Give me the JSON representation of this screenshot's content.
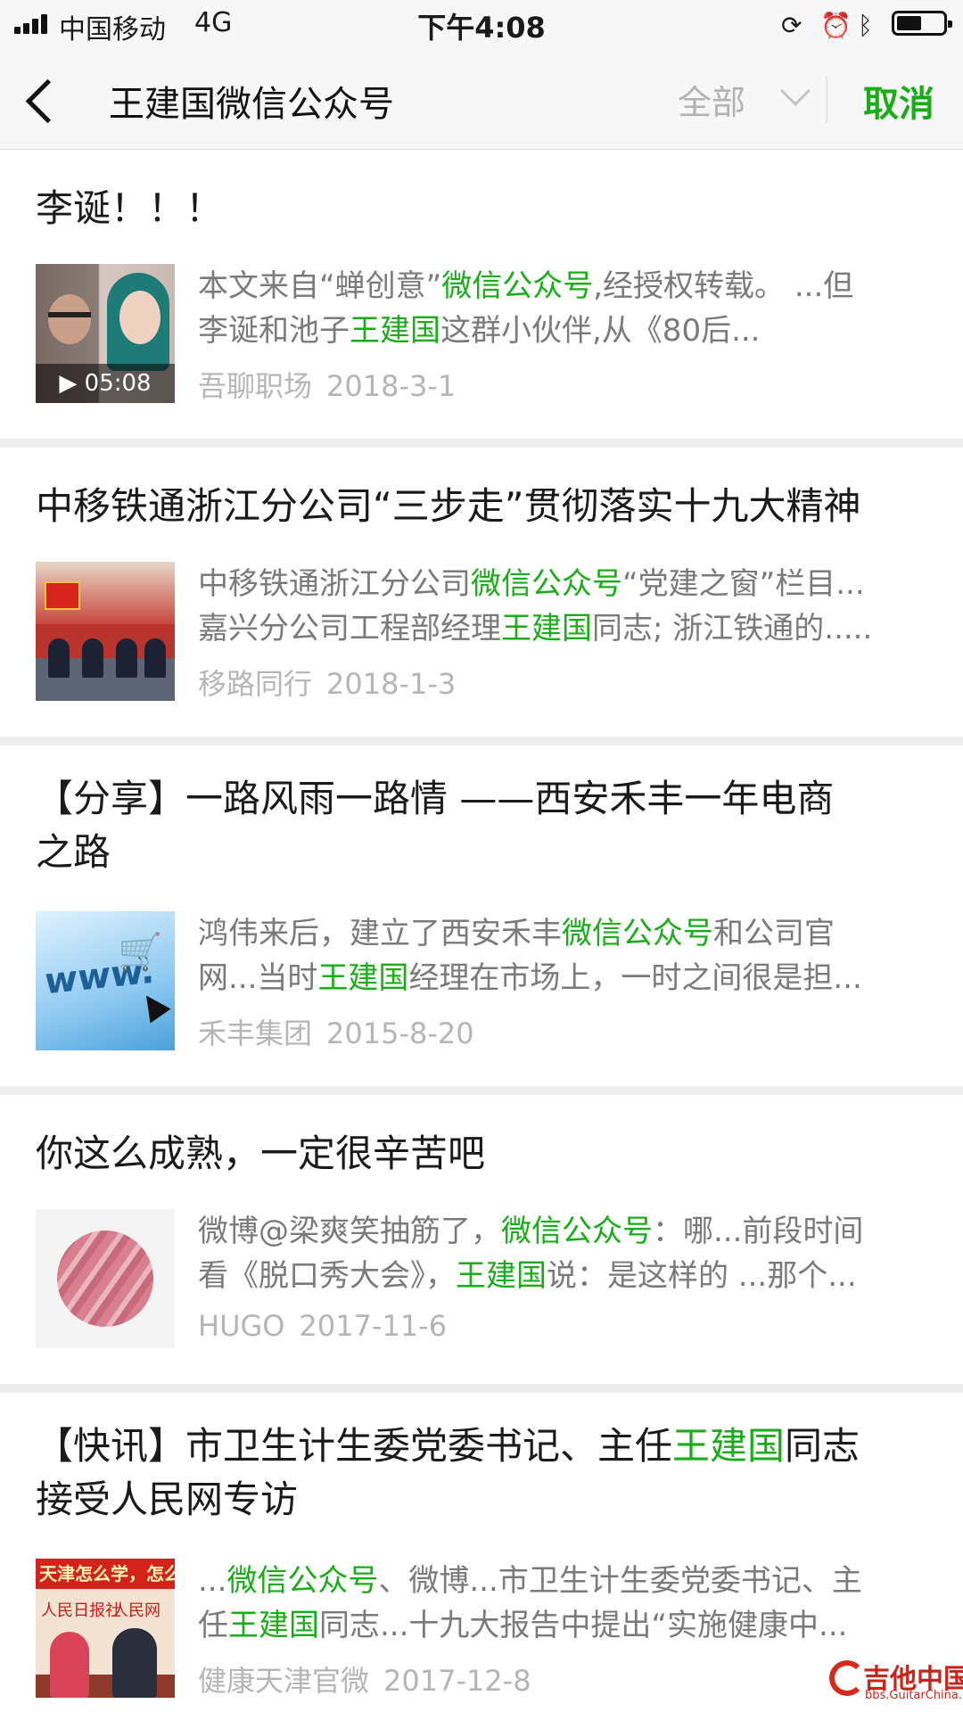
{
  "status_bar": {
    "carrier": "中国移动",
    "network": "4G",
    "time": "下午4:08"
  },
  "header": {
    "title": "王建国微信公众号",
    "filter_label": "全部",
    "cancel_label": "取消"
  },
  "colors": {
    "accent_green": "#1aad19",
    "snippet_gray": "#7a7a7a",
    "meta_gray": "#b5b5b5"
  },
  "results": [
    {
      "title": "李诞！！！",
      "thumb_duration": "▶ 05:08",
      "line1": {
        "a": "本文来自“蝉创意”",
        "hl": "微信公众号",
        "b": ",经授权转载。 ...但"
      },
      "line2": {
        "a": "李诞和池子",
        "hl": "王建国",
        "b": "这群小伙伴,从《80后..."
      },
      "source": "吾聊职场",
      "date": "2018-3-1"
    },
    {
      "title": "中移铁通浙江分公司“三步走”贯彻落实十九大精神",
      "line1": {
        "a": "中移铁通浙江分公司",
        "hl": "微信公众号",
        "b": "“党建之窗”栏目..."
      },
      "line2": {
        "a": "嘉兴分公司工程部经理",
        "hl": "王建国",
        "b": "同志; 浙江铁通的....."
      },
      "source": "移路同行",
      "date": "2018-1-3"
    },
    {
      "title_line1": "【分享】一路风雨一路情 ——西安禾丰一年电商",
      "title_line2": "之路",
      "line1": {
        "a": "鸿伟来后，建立了西安禾丰",
        "hl": "微信公众号",
        "b": "和公司官"
      },
      "line2": {
        "a": "网...当时",
        "hl": "王建国",
        "b": "经理在市场上，一时之间很是担..."
      },
      "source": "禾丰集团",
      "date": "2015-8-20"
    },
    {
      "title": "你这么成熟，一定很辛苦吧",
      "line1": {
        "a": "微博@梁爽笑抽筋了，",
        "hl": "微信公众号",
        "b": "：哪...前段时间"
      },
      "line2": {
        "a": "看《脱口秀大会》，",
        "hl": "王建国",
        "b": "说：是这样的 ...那个..."
      },
      "source": "HUGO",
      "date": "2017-11-6"
    },
    {
      "title_line1": {
        "a": "【快讯】市卫生计生委党委书记、主任",
        "hl": "王建国",
        "b": "同志"
      },
      "title_line2": "接受人民网专访",
      "thumb_banner": "天津怎么学，怎么干",
      "thumb_logo_left": "人民日报社",
      "thumb_logo_right": "人民网",
      "line1": {
        "a": "...",
        "hl": "微信公众号",
        "b": "、微博...市卫生计生委党委书记、主"
      },
      "line2": {
        "a": "任",
        "hl": "王建国",
        "b": "同志...十九大报告中提出“实施健康中..."
      },
      "source": "健康天津官微",
      "date": "2017-12-8"
    }
  ],
  "watermark": {
    "text": "吉他中国",
    "url": "bbs.GuitarChina.com"
  }
}
